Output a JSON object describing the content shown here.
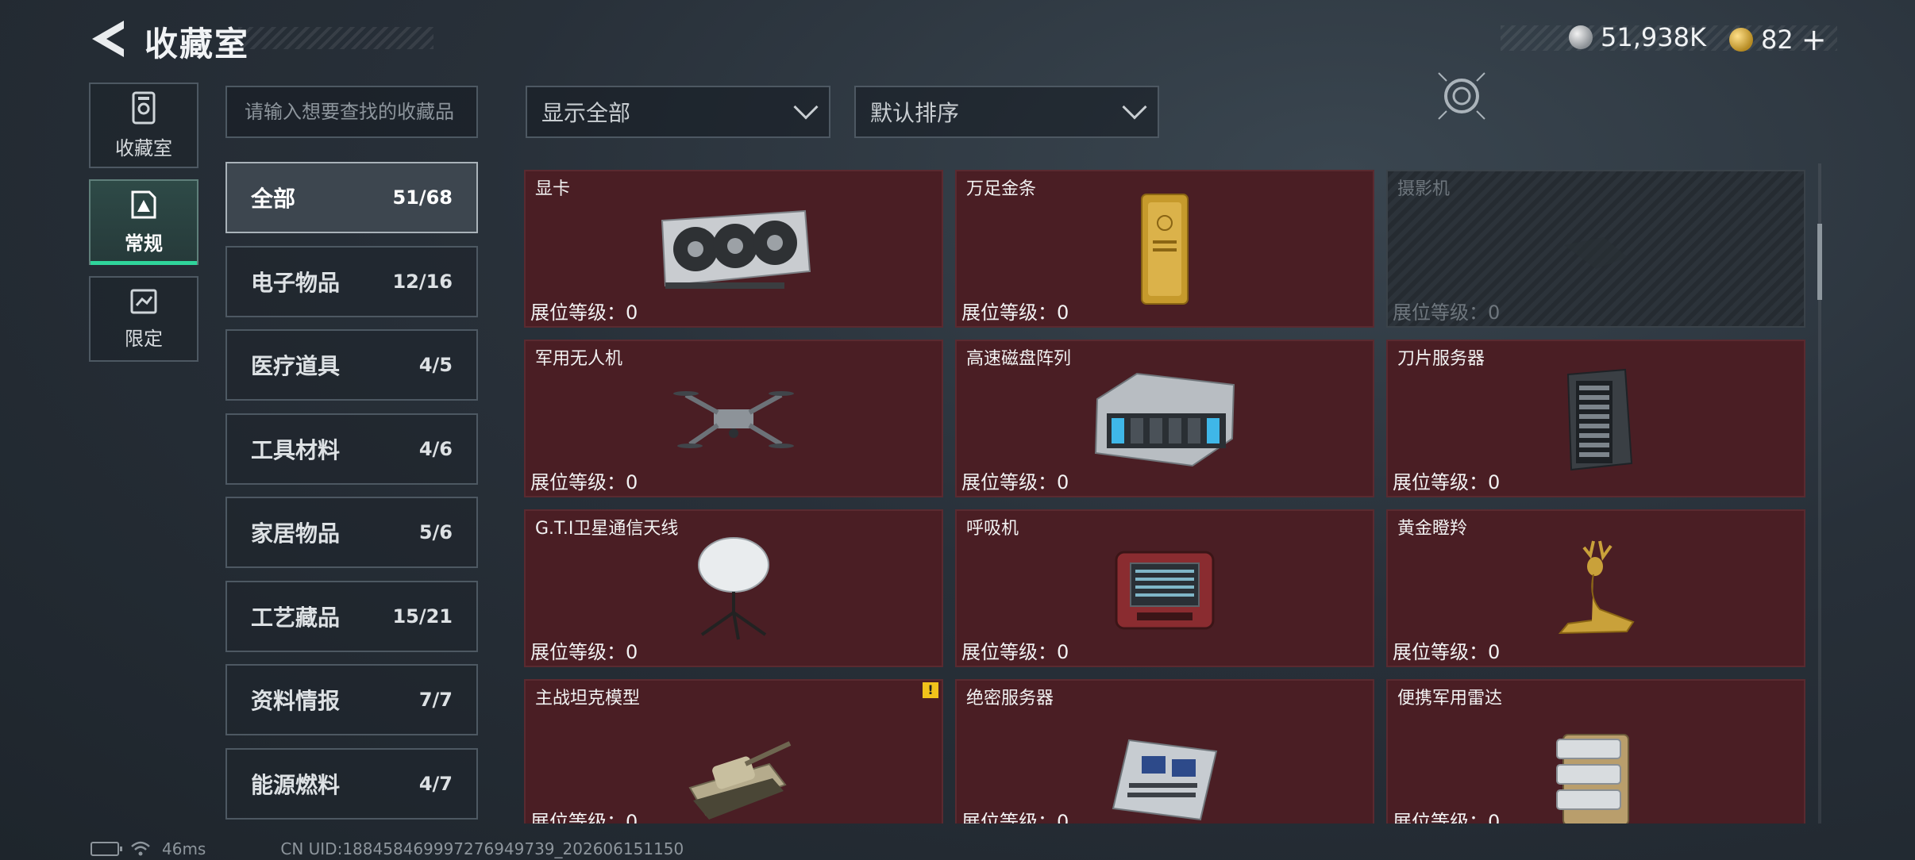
{
  "header": {
    "title": "收藏室",
    "currency": [
      {
        "icon": "silver-coin-icon",
        "value": "51,938K"
      },
      {
        "icon": "gold-coin-icon",
        "value": "82"
      }
    ],
    "add_symbol": "+"
  },
  "nav_tabs": [
    {
      "label": "收藏室",
      "icon": "collection-room-icon",
      "active": false
    },
    {
      "label": "常规",
      "icon": "regular-icon",
      "active": true
    },
    {
      "label": "限定",
      "icon": "limited-icon",
      "active": false
    }
  ],
  "search": {
    "placeholder": "请输入想要查找的收藏品"
  },
  "categories": [
    {
      "name": "全部",
      "count": "51/68",
      "active": true
    },
    {
      "name": "电子物品",
      "count": "12/16"
    },
    {
      "name": "医疗道具",
      "count": "4/5"
    },
    {
      "name": "工具材料",
      "count": "4/6"
    },
    {
      "name": "家居物品",
      "count": "5/6"
    },
    {
      "name": "工艺藏品",
      "count": "15/21"
    },
    {
      "name": "资料情报",
      "count": "7/7"
    },
    {
      "name": "能源燃料",
      "count": "4/7"
    }
  ],
  "filters": {
    "show": "显示全部",
    "sort": "默认排序"
  },
  "level_label": "展位等级：0",
  "items": [
    {
      "name": "显卡",
      "art": "graphics-card",
      "locked": false
    },
    {
      "name": "万足金条",
      "art": "gold-bar",
      "locked": false
    },
    {
      "name": "摄影机",
      "art": "camera",
      "locked": true
    },
    {
      "name": "军用无人机",
      "art": "drone",
      "locked": false
    },
    {
      "name": "高速磁盘阵列",
      "art": "disk-array",
      "locked": false
    },
    {
      "name": "刀片服务器",
      "art": "blade-server",
      "locked": false
    },
    {
      "name": "G.T.I卫星通信天线",
      "art": "satellite-antenna",
      "locked": false
    },
    {
      "name": "呼吸机",
      "art": "ventilator",
      "locked": false
    },
    {
      "name": "黄金瞪羚",
      "art": "golden-gazelle",
      "locked": false
    },
    {
      "name": "主战坦克模型",
      "art": "tank-model",
      "locked": false,
      "warning": "!"
    },
    {
      "name": "绝密服务器",
      "art": "secret-server",
      "locked": false
    },
    {
      "name": "便携军用雷达",
      "art": "portable-radar",
      "locked": false
    }
  ],
  "footer": {
    "ping": "46ms",
    "uid": "CN UID:18845846999727694973​9_202606151150"
  },
  "colors": {
    "card_bg": "#4a1e24",
    "active_tab_accent": "#2fd49b",
    "locked_card": "#2c333a"
  }
}
